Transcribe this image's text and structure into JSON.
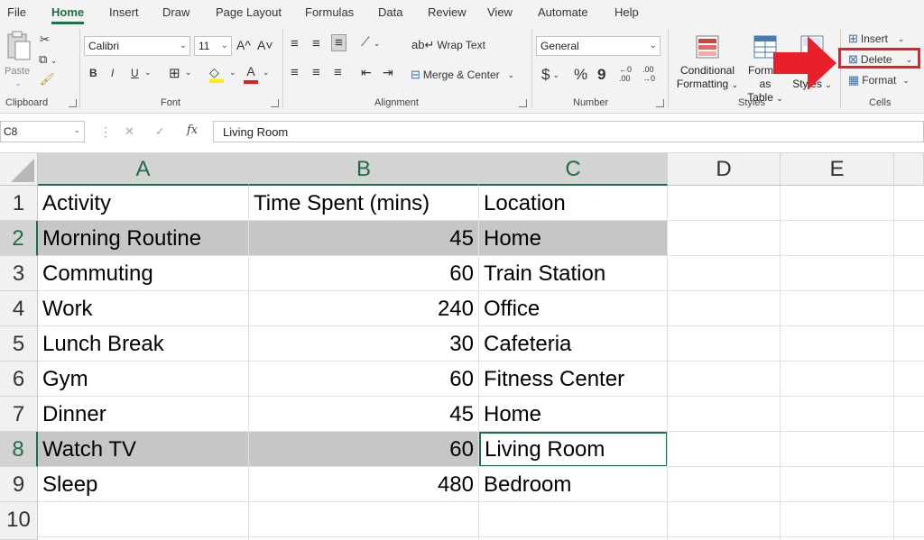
{
  "menu": {
    "tabs": [
      "File",
      "Home",
      "Insert",
      "Draw",
      "Page Layout",
      "Formulas",
      "Data",
      "Review",
      "View",
      "Automate",
      "Help"
    ],
    "active": "Home"
  },
  "ribbon": {
    "clipboard": {
      "paste_label": "Paste",
      "group_label": "Clipboard"
    },
    "font": {
      "font_name": "Calibri",
      "font_size": "11",
      "grow": "A^",
      "shrink": "A˅",
      "bold": "B",
      "italic": "I",
      "underline": "U",
      "group_label": "Font"
    },
    "alignment": {
      "wrap_text": "Wrap Text",
      "merge_center": "Merge & Center",
      "group_label": "Alignment"
    },
    "number": {
      "format": "General",
      "currency": "$",
      "percent": "%",
      "comma": "9",
      "inc_decimal": "←0 .00",
      "dec_decimal": ".00 →0",
      "group_label": "Number"
    },
    "styles": {
      "conditional_line1": "Conditional",
      "conditional_line2": "Formatting",
      "format_table_line1": "Format as",
      "format_table_line2": "Table",
      "cell_styles_line2": "Styles",
      "group_label": "Styles"
    },
    "cells": {
      "insert": "Insert",
      "delete": "Delete",
      "format": "Format",
      "group_label": "Cells"
    }
  },
  "formula_bar": {
    "name_box": "C8",
    "cancel": "✕",
    "enter": "✓",
    "fx": "fx",
    "value": "Living Room"
  },
  "columns": [
    "A",
    "B",
    "C",
    "D",
    "E"
  ],
  "rows": [
    "1",
    "2",
    "3",
    "4",
    "5",
    "6",
    "7",
    "8",
    "9",
    "10"
  ],
  "table": {
    "headers": [
      "Activity",
      "Time Spent (mins)",
      "Location"
    ],
    "data": [
      [
        "Morning Routine",
        "45",
        "Home"
      ],
      [
        "Commuting",
        "60",
        "Train Station"
      ],
      [
        "Work",
        "240",
        "Office"
      ],
      [
        "Lunch Break",
        "30",
        "Cafeteria"
      ],
      [
        "Gym",
        "60",
        "Fitness Center"
      ],
      [
        "Dinner",
        "45",
        "Home"
      ],
      [
        "Watch TV",
        "60",
        "Living Room"
      ],
      [
        "Sleep",
        "480",
        "Bedroom"
      ]
    ]
  },
  "colors": {
    "accent_green": "#1e7145",
    "highlight_gray": "#c6c6c6",
    "annotation_red": "#e8202a"
  }
}
